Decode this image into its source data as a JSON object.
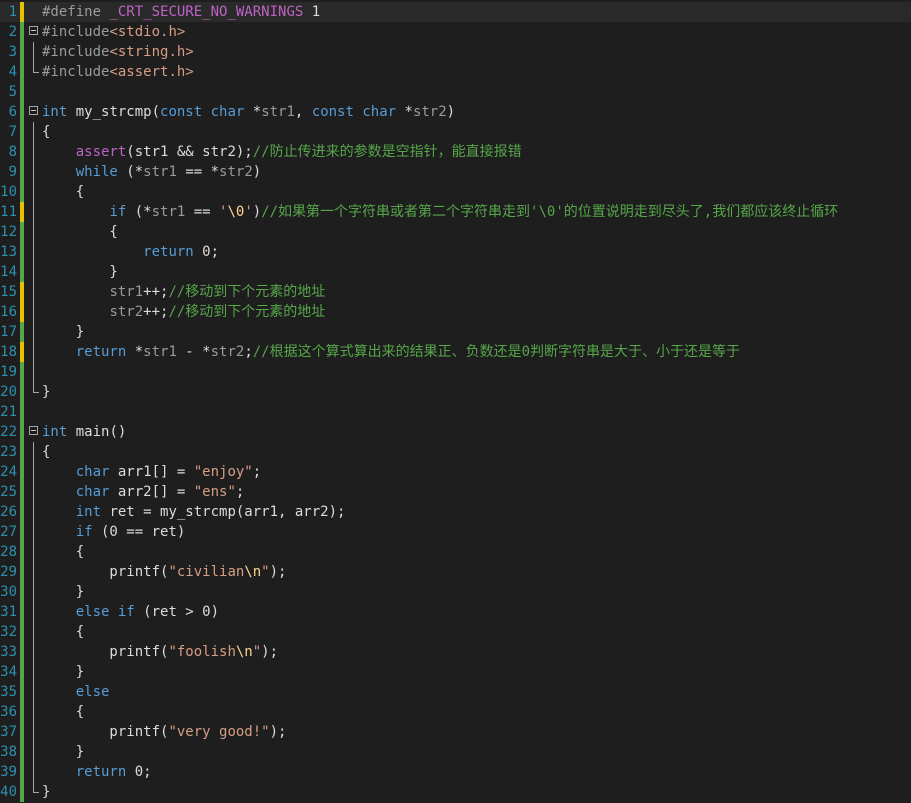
{
  "editor": {
    "colors": {
      "background": "#1e1e1e",
      "line_number": "#2b91af",
      "keyword": "#569cd6",
      "comment": "#57a64a",
      "string": "#d69d85",
      "macro": "#bd63c5",
      "change_saved": "#57a64a",
      "change_unsaved": "#e5c100"
    },
    "lines": [
      {
        "n": "1",
        "change": "unsaved",
        "tokens": [
          {
            "t": "#define ",
            "c": "preproc"
          },
          {
            "t": "_CRT_SECURE_NO_WARNINGS",
            "c": "macro"
          },
          {
            "t": " 1",
            "c": "text"
          }
        ]
      },
      {
        "n": "2",
        "change": "saved",
        "fold": "open",
        "tokens": [
          {
            "t": "#include",
            "c": "preproc"
          },
          {
            "t": "<stdio.h>",
            "c": "string"
          }
        ]
      },
      {
        "n": "3",
        "change": "saved",
        "guide": "line",
        "tokens": [
          {
            "t": "#include",
            "c": "preproc"
          },
          {
            "t": "<string.h>",
            "c": "string"
          }
        ]
      },
      {
        "n": "4",
        "change": "saved",
        "guide": "end",
        "tokens": [
          {
            "t": "#include",
            "c": "preproc"
          },
          {
            "t": "<assert.h>",
            "c": "string"
          }
        ]
      },
      {
        "n": "5",
        "change": "saved",
        "tokens": []
      },
      {
        "n": "6",
        "change": "saved",
        "fold": "open",
        "tokens": [
          {
            "t": "int",
            "c": "keyword"
          },
          {
            "t": " my_strcmp(",
            "c": "text"
          },
          {
            "t": "const",
            "c": "keyword"
          },
          {
            "t": " ",
            "c": "text"
          },
          {
            "t": "char",
            "c": "keyword"
          },
          {
            "t": " *",
            "c": "text"
          },
          {
            "t": "str1",
            "c": "param"
          },
          {
            "t": ", ",
            "c": "text"
          },
          {
            "t": "const",
            "c": "keyword"
          },
          {
            "t": " ",
            "c": "text"
          },
          {
            "t": "char",
            "c": "keyword"
          },
          {
            "t": " *",
            "c": "text"
          },
          {
            "t": "str2",
            "c": "param"
          },
          {
            "t": ")",
            "c": "text"
          }
        ]
      },
      {
        "n": "7",
        "change": "saved",
        "guide": "line",
        "tokens": [
          {
            "t": "{",
            "c": "text"
          }
        ]
      },
      {
        "n": "8",
        "change": "saved",
        "guide": "line",
        "tokens": [
          {
            "t": "    ",
            "c": "text"
          },
          {
            "t": "assert",
            "c": "macro"
          },
          {
            "t": "(str1 && str2);",
            "c": "text"
          },
          {
            "t": "//防止传进来的参数是空指针，能直接报错",
            "c": "comment"
          }
        ]
      },
      {
        "n": "9",
        "change": "saved",
        "guide": "line",
        "tokens": [
          {
            "t": "    ",
            "c": "text"
          },
          {
            "t": "while",
            "c": "keyword"
          },
          {
            "t": " (*",
            "c": "text"
          },
          {
            "t": "str1",
            "c": "param"
          },
          {
            "t": " == *",
            "c": "text"
          },
          {
            "t": "str2",
            "c": "param"
          },
          {
            "t": ")",
            "c": "text"
          }
        ]
      },
      {
        "n": "10",
        "change": "saved",
        "guide": "line",
        "tokens": [
          {
            "t": "    {",
            "c": "text"
          }
        ]
      },
      {
        "n": "11",
        "change": "unsaved",
        "guide": "line",
        "tokens": [
          {
            "t": "        ",
            "c": "text"
          },
          {
            "t": "if",
            "c": "keyword"
          },
          {
            "t": " (*",
            "c": "text"
          },
          {
            "t": "str1",
            "c": "param"
          },
          {
            "t": " == ",
            "c": "text"
          },
          {
            "t": "'",
            "c": "string"
          },
          {
            "t": "\\0",
            "c": "escape"
          },
          {
            "t": "'",
            "c": "string"
          },
          {
            "t": ")",
            "c": "text"
          },
          {
            "t": "//如果第一个字符串或者第二个字符串走到'\\0'的位置说明走到尽头了,我们都应该终止循环",
            "c": "comment"
          }
        ]
      },
      {
        "n": "12",
        "change": "saved",
        "guide": "line",
        "tokens": [
          {
            "t": "        {",
            "c": "text"
          }
        ]
      },
      {
        "n": "13",
        "change": "saved",
        "guide": "line",
        "tokens": [
          {
            "t": "            ",
            "c": "text"
          },
          {
            "t": "return",
            "c": "keyword"
          },
          {
            "t": " 0;",
            "c": "text"
          }
        ]
      },
      {
        "n": "14",
        "change": "saved",
        "guide": "line",
        "tokens": [
          {
            "t": "        }",
            "c": "text"
          }
        ]
      },
      {
        "n": "15",
        "change": "unsaved",
        "guide": "line",
        "tokens": [
          {
            "t": "        ",
            "c": "text"
          },
          {
            "t": "str1",
            "c": "param"
          },
          {
            "t": "++;",
            "c": "text"
          },
          {
            "t": "//移动到下个元素的地址",
            "c": "comment"
          }
        ]
      },
      {
        "n": "16",
        "change": "unsaved",
        "guide": "line",
        "tokens": [
          {
            "t": "        ",
            "c": "text"
          },
          {
            "t": "str2",
            "c": "param"
          },
          {
            "t": "++;",
            "c": "text"
          },
          {
            "t": "//移动到下个元素的地址",
            "c": "comment"
          }
        ]
      },
      {
        "n": "17",
        "change": "saved",
        "guide": "line",
        "tokens": [
          {
            "t": "    }",
            "c": "text"
          }
        ]
      },
      {
        "n": "18",
        "change": "unsaved",
        "guide": "line",
        "tokens": [
          {
            "t": "    ",
            "c": "text"
          },
          {
            "t": "return",
            "c": "keyword"
          },
          {
            "t": " *",
            "c": "text"
          },
          {
            "t": "str1",
            "c": "param"
          },
          {
            "t": " - *",
            "c": "text"
          },
          {
            "t": "str2",
            "c": "param"
          },
          {
            "t": ";",
            "c": "text"
          },
          {
            "t": "//根据这个算式算出来的结果正、负数还是0判断字符串是大于、小于还是等于",
            "c": "comment"
          }
        ]
      },
      {
        "n": "19",
        "change": "saved",
        "guide": "line",
        "tokens": []
      },
      {
        "n": "20",
        "change": "saved",
        "guide": "end",
        "tokens": [
          {
            "t": "}",
            "c": "text"
          }
        ]
      },
      {
        "n": "21",
        "change": "saved",
        "tokens": []
      },
      {
        "n": "22",
        "change": "saved",
        "fold": "open",
        "tokens": [
          {
            "t": "int",
            "c": "keyword"
          },
          {
            "t": " main()",
            "c": "text"
          }
        ]
      },
      {
        "n": "23",
        "change": "saved",
        "guide": "line",
        "tokens": [
          {
            "t": "{",
            "c": "text"
          }
        ]
      },
      {
        "n": "24",
        "change": "saved",
        "guide": "line",
        "tokens": [
          {
            "t": "    ",
            "c": "text"
          },
          {
            "t": "char",
            "c": "keyword"
          },
          {
            "t": " arr1[] = ",
            "c": "text"
          },
          {
            "t": "\"enjoy\"",
            "c": "string"
          },
          {
            "t": ";",
            "c": "text"
          }
        ]
      },
      {
        "n": "25",
        "change": "saved",
        "guide": "line",
        "tokens": [
          {
            "t": "    ",
            "c": "text"
          },
          {
            "t": "char",
            "c": "keyword"
          },
          {
            "t": " arr2[] = ",
            "c": "text"
          },
          {
            "t": "\"ens\"",
            "c": "string"
          },
          {
            "t": ";",
            "c": "text"
          }
        ]
      },
      {
        "n": "26",
        "change": "saved",
        "guide": "line",
        "tokens": [
          {
            "t": "    ",
            "c": "text"
          },
          {
            "t": "int",
            "c": "keyword"
          },
          {
            "t": " ret = my_strcmp(arr1, arr2);",
            "c": "text"
          }
        ]
      },
      {
        "n": "27",
        "change": "saved",
        "guide": "line",
        "tokens": [
          {
            "t": "    ",
            "c": "text"
          },
          {
            "t": "if",
            "c": "keyword"
          },
          {
            "t": " (0 == ret)",
            "c": "text"
          }
        ]
      },
      {
        "n": "28",
        "change": "saved",
        "guide": "line",
        "tokens": [
          {
            "t": "    {",
            "c": "text"
          }
        ]
      },
      {
        "n": "29",
        "change": "saved",
        "guide": "line",
        "tokens": [
          {
            "t": "        printf(",
            "c": "text"
          },
          {
            "t": "\"civilian",
            "c": "string"
          },
          {
            "t": "\\n",
            "c": "escape"
          },
          {
            "t": "\"",
            "c": "string"
          },
          {
            "t": ");",
            "c": "text"
          }
        ]
      },
      {
        "n": "30",
        "change": "saved",
        "guide": "line",
        "tokens": [
          {
            "t": "    }",
            "c": "text"
          }
        ]
      },
      {
        "n": "31",
        "change": "saved",
        "guide": "line",
        "tokens": [
          {
            "t": "    ",
            "c": "text"
          },
          {
            "t": "else",
            "c": "keyword"
          },
          {
            "t": " ",
            "c": "text"
          },
          {
            "t": "if",
            "c": "keyword"
          },
          {
            "t": " (ret > 0)",
            "c": "text"
          }
        ]
      },
      {
        "n": "32",
        "change": "saved",
        "guide": "line",
        "tokens": [
          {
            "t": "    {",
            "c": "text"
          }
        ]
      },
      {
        "n": "33",
        "change": "saved",
        "guide": "line",
        "tokens": [
          {
            "t": "        printf(",
            "c": "text"
          },
          {
            "t": "\"foolish",
            "c": "string"
          },
          {
            "t": "\\n",
            "c": "escape"
          },
          {
            "t": "\"",
            "c": "string"
          },
          {
            "t": ");",
            "c": "text"
          }
        ]
      },
      {
        "n": "34",
        "change": "saved",
        "guide": "line",
        "tokens": [
          {
            "t": "    }",
            "c": "text"
          }
        ]
      },
      {
        "n": "35",
        "change": "saved",
        "guide": "line",
        "tokens": [
          {
            "t": "    ",
            "c": "text"
          },
          {
            "t": "else",
            "c": "keyword"
          }
        ]
      },
      {
        "n": "36",
        "change": "saved",
        "guide": "line",
        "tokens": [
          {
            "t": "    {",
            "c": "text"
          }
        ]
      },
      {
        "n": "37",
        "change": "saved",
        "guide": "line",
        "tokens": [
          {
            "t": "        printf(",
            "c": "text"
          },
          {
            "t": "\"very good!\"",
            "c": "string"
          },
          {
            "t": ");",
            "c": "text"
          }
        ]
      },
      {
        "n": "38",
        "change": "saved",
        "guide": "line",
        "tokens": [
          {
            "t": "    }",
            "c": "text"
          }
        ]
      },
      {
        "n": "39",
        "change": "saved",
        "guide": "line",
        "tokens": [
          {
            "t": "    ",
            "c": "text"
          },
          {
            "t": "return",
            "c": "keyword"
          },
          {
            "t": " 0;",
            "c": "text"
          }
        ]
      },
      {
        "n": "40",
        "change": "saved",
        "guide": "end",
        "tokens": [
          {
            "t": "}",
            "c": "text"
          }
        ]
      }
    ]
  }
}
